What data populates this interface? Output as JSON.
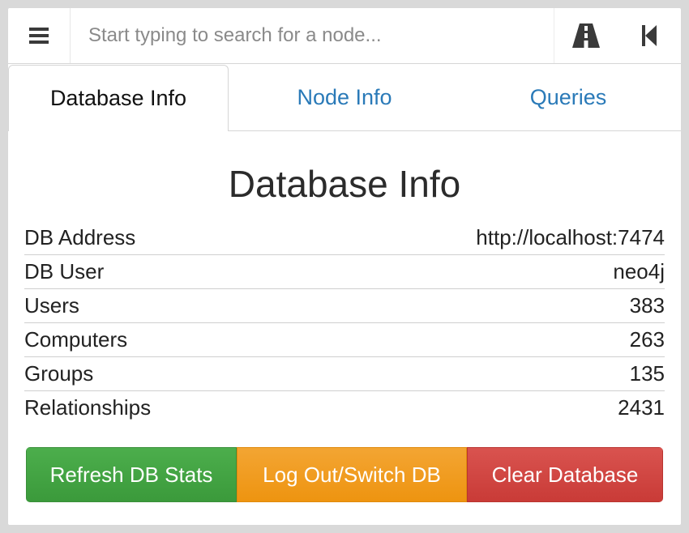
{
  "search": {
    "placeholder": "Start typing to search for a node...",
    "value": ""
  },
  "icons": {
    "menu": "hamburger-menu-icon",
    "pathfinding": "road-icon",
    "back": "step-backward-icon"
  },
  "tabs": [
    {
      "label": "Database Info",
      "active": true
    },
    {
      "label": "Node Info",
      "active": false
    },
    {
      "label": "Queries",
      "active": false
    }
  ],
  "main": {
    "title": "Database Info",
    "rows": [
      {
        "label": "DB Address",
        "value": "http://localhost:7474"
      },
      {
        "label": "DB User",
        "value": "neo4j"
      },
      {
        "label": "Users",
        "value": "383"
      },
      {
        "label": "Computers",
        "value": "263"
      },
      {
        "label": "Groups",
        "value": "135"
      },
      {
        "label": "Relationships",
        "value": "2431"
      }
    ]
  },
  "buttons": {
    "refresh": "Refresh DB Stats",
    "logout": "Log Out/Switch DB",
    "clear": "Clear Database"
  },
  "colors": {
    "link": "#2a7ab8",
    "success": "#44a544",
    "warning": "#f09c1e",
    "danger": "#d14642"
  }
}
